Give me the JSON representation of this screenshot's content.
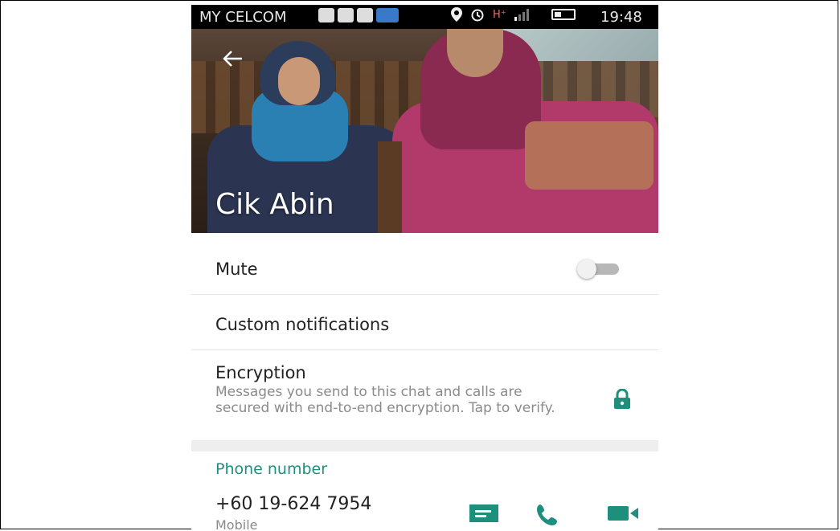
{
  "status_bar": {
    "carrier": "MY CELCOM",
    "network": "H⁺",
    "time": "19:48"
  },
  "header": {
    "back_icon": "arrow-left-icon",
    "contact_name": "Cik Abin"
  },
  "settings": {
    "mute_label": "Mute",
    "mute_on": false,
    "custom_notifications_label": "Custom notifications",
    "encryption_label": "Encryption",
    "encryption_desc": "Messages you send to this chat and calls are secured with end-to-end encryption. Tap to verify.",
    "encryption_icon": "lock-icon"
  },
  "phone_section": {
    "title": "Phone number",
    "number": "+60 19-624 7954",
    "type": "Mobile",
    "actions": [
      "message-icon",
      "call-icon",
      "video-call-icon"
    ]
  },
  "colors": {
    "accent": "#1d8f7c",
    "status_bar": "#000000"
  }
}
